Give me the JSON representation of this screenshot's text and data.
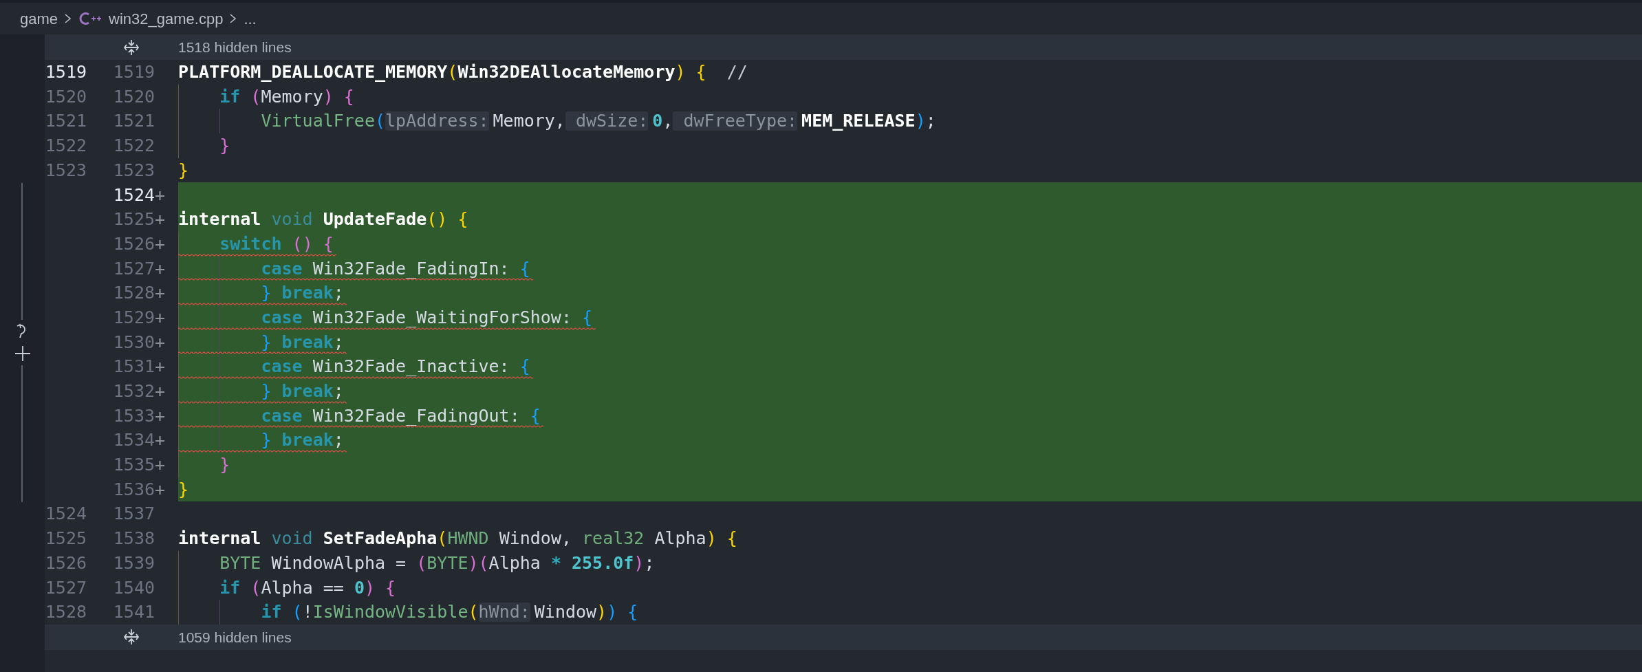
{
  "breadcrumb": [
    {
      "kind": "folder",
      "text": "game"
    },
    {
      "kind": "file",
      "text": "win32_game.cpp"
    },
    {
      "kind": "more",
      "text": "..."
    }
  ],
  "editor": {
    "hidden_top": {
      "label": "1518 hidden lines"
    },
    "lines": [
      {
        "kind": "context",
        "old": "1519",
        "new": "1519",
        "active": true,
        "error": false,
        "tokens": [
          {
            "kind": "macro",
            "text": "PLATFORM_DEALLOCATE_MEMORY"
          },
          {
            "kind": "bracket",
            "text": "(",
            "color": "#ffd700"
          },
          {
            "kind": "macro",
            "text": "Win32DEAllocateMemory"
          },
          {
            "kind": "bracket",
            "text": ")",
            "color": "#ffd700"
          },
          {
            "kind": "bracket",
            "text": "{",
            "color": "#ffd700",
            "spaced": true
          },
          {
            "kind": "comment",
            "text": "//",
            "spaced": true,
            "wide": true
          }
        ]
      },
      {
        "kind": "context",
        "old": "1520",
        "new": "1520",
        "active": false,
        "error": false,
        "guides": [
          true
        ],
        "tokens": [
          {
            "kind": "keyword",
            "text": "if"
          },
          {
            "kind": "bracket",
            "text": "(",
            "color": "#da70d6",
            "spaced": true
          },
          {
            "kind": "plain",
            "text": "Memory"
          },
          {
            "kind": "bracket",
            "text": ")",
            "color": "#da70d6"
          },
          {
            "kind": "bracket",
            "text": "{",
            "color": "#da70d6",
            "spaced": true
          }
        ]
      },
      {
        "kind": "context",
        "old": "1521",
        "new": "1521",
        "active": false,
        "error": false,
        "guides": [
          true,
          true
        ],
        "tokens": [
          {
            "kind": "call",
            "text": "VirtualFree"
          },
          {
            "kind": "bracket",
            "text": "(",
            "color": "#179fff"
          },
          {
            "kind": "hint",
            "text": "lpAddress:"
          },
          {
            "kind": "plain",
            "text": "Memory,"
          },
          {
            "kind": "hint",
            "text": "dwSize:",
            "spaced": true
          },
          {
            "kind": "number",
            "text": "0"
          },
          {
            "kind": "plain",
            "text": ","
          },
          {
            "kind": "hint",
            "text": "dwFreeType:",
            "spaced": true
          },
          {
            "kind": "constant",
            "text": "MEM_RELEASE"
          },
          {
            "kind": "bracket",
            "text": ")",
            "color": "#179fff"
          },
          {
            "kind": "plain",
            "text": ";"
          }
        ]
      },
      {
        "kind": "context",
        "old": "1522",
        "new": "1522",
        "active": false,
        "error": false,
        "guides": [
          true
        ],
        "tokens": [
          {
            "kind": "bracket",
            "text": "}",
            "color": "#da70d6"
          }
        ]
      },
      {
        "kind": "context",
        "old": "1523",
        "new": "1523",
        "active": false,
        "error": false,
        "tokens": [
          {
            "kind": "bracket",
            "text": "}",
            "color": "#ffd700"
          }
        ]
      },
      {
        "kind": "added",
        "new": "1524",
        "marker": "+",
        "active": true,
        "error": false
      },
      {
        "kind": "added",
        "new": "1525",
        "marker": "+",
        "active": false,
        "error": false,
        "tokens": [
          {
            "kind": "storage",
            "text": "internal"
          },
          {
            "kind": "type",
            "text": "void",
            "spaced": true
          },
          {
            "kind": "function",
            "text": "UpdateFade",
            "spaced": true
          },
          {
            "kind": "bracket",
            "text": "(",
            "color": "#ffd700"
          },
          {
            "kind": "bracket",
            "text": ")",
            "color": "#ffd700"
          },
          {
            "kind": "bracket",
            "text": "{",
            "color": "#ffd700",
            "spaced": true
          }
        ]
      },
      {
        "kind": "added",
        "new": "1526",
        "marker": "+",
        "active": false,
        "error": true,
        "guides": [
          true
        ],
        "tokens": [
          {
            "kind": "keyword",
            "text": "switch"
          },
          {
            "kind": "bracket",
            "text": "(",
            "color": "#da70d6",
            "spaced": true
          },
          {
            "kind": "bracket",
            "text": ")",
            "color": "#da70d6"
          },
          {
            "kind": "bracket",
            "text": "{",
            "color": "#da70d6",
            "spaced": true
          }
        ]
      },
      {
        "kind": "added",
        "new": "1527",
        "marker": "+",
        "active": false,
        "error": true,
        "guides": [
          true,
          true
        ],
        "tokens": [
          {
            "kind": "keyword",
            "text": "case"
          },
          {
            "kind": "plain",
            "text": "Win32Fade_FadingIn:",
            "spaced": true
          },
          {
            "kind": "bracket",
            "text": "{",
            "color": "#179fff",
            "spaced": true
          }
        ]
      },
      {
        "kind": "added",
        "new": "1528",
        "marker": "+",
        "active": false,
        "error": true,
        "guides": [
          true,
          true
        ],
        "tokens": [
          {
            "kind": "bracket",
            "text": "}",
            "color": "#179fff"
          },
          {
            "kind": "keyword",
            "text": "break",
            "spaced": true
          },
          {
            "kind": "plain",
            "text": ";"
          }
        ]
      },
      {
        "kind": "added",
        "new": "1529",
        "marker": "+",
        "active": false,
        "error": true,
        "guides": [
          true,
          true
        ],
        "tokens": [
          {
            "kind": "keyword",
            "text": "case"
          },
          {
            "kind": "plain",
            "text": "Win32Fade_WaitingForShow:",
            "spaced": true
          },
          {
            "kind": "bracket",
            "text": "{",
            "color": "#179fff",
            "spaced": true
          }
        ]
      },
      {
        "kind": "added",
        "new": "1530",
        "marker": "+",
        "active": false,
        "error": true,
        "guides": [
          true,
          true
        ],
        "tokens": [
          {
            "kind": "bracket",
            "text": "}",
            "color": "#179fff"
          },
          {
            "kind": "keyword",
            "text": "break",
            "spaced": true
          },
          {
            "kind": "plain",
            "text": ";"
          }
        ]
      },
      {
        "kind": "added",
        "new": "1531",
        "marker": "+",
        "active": false,
        "error": true,
        "guides": [
          true,
          true
        ],
        "tokens": [
          {
            "kind": "keyword",
            "text": "case"
          },
          {
            "kind": "plain",
            "text": "Win32Fade_Inactive:",
            "spaced": true
          },
          {
            "kind": "bracket",
            "text": "{",
            "color": "#179fff",
            "spaced": true
          }
        ]
      },
      {
        "kind": "added",
        "new": "1532",
        "marker": "+",
        "active": false,
        "error": true,
        "guides": [
          true,
          true
        ],
        "tokens": [
          {
            "kind": "bracket",
            "text": "}",
            "color": "#179fff"
          },
          {
            "kind": "keyword",
            "text": "break",
            "spaced": true
          },
          {
            "kind": "plain",
            "text": ";"
          }
        ]
      },
      {
        "kind": "added",
        "new": "1533",
        "marker": "+",
        "active": false,
        "error": true,
        "guides": [
          true,
          true
        ],
        "tokens": [
          {
            "kind": "keyword",
            "text": "case"
          },
          {
            "kind": "plain",
            "text": "Win32Fade_FadingOut:",
            "spaced": true
          },
          {
            "kind": "bracket",
            "text": "{",
            "color": "#179fff",
            "spaced": true
          }
        ]
      },
      {
        "kind": "added",
        "new": "1534",
        "marker": "+",
        "active": false,
        "error": true,
        "guides": [
          true,
          true
        ],
        "tokens": [
          {
            "kind": "bracket",
            "text": "}",
            "color": "#179fff"
          },
          {
            "kind": "keyword",
            "text": "break",
            "spaced": true
          },
          {
            "kind": "plain",
            "text": ";"
          }
        ]
      },
      {
        "kind": "added",
        "new": "1535",
        "marker": "+",
        "active": false,
        "error": false,
        "guides": [
          true
        ],
        "tokens": [
          {
            "kind": "bracket",
            "text": "}",
            "color": "#da70d6"
          }
        ]
      },
      {
        "kind": "added",
        "new": "1536",
        "marker": "+",
        "active": false,
        "error": false,
        "tokens": [
          {
            "kind": "bracket",
            "text": "}",
            "color": "#ffd700"
          }
        ]
      },
      {
        "kind": "context",
        "old": "1524",
        "new": "1537",
        "active": false,
        "error": false
      },
      {
        "kind": "context",
        "old": "1525",
        "new": "1538",
        "active": false,
        "error": false,
        "tokens": [
          {
            "kind": "storage",
            "text": "internal"
          },
          {
            "kind": "type",
            "text": "void",
            "spaced": true
          },
          {
            "kind": "function",
            "text": "SetFadeApha",
            "spaced": true
          },
          {
            "kind": "bracket",
            "text": "(",
            "color": "#ffd700"
          },
          {
            "kind": "typename",
            "text": "HWND"
          },
          {
            "kind": "plain",
            "text": "Window,",
            "spaced": true
          },
          {
            "kind": "typename",
            "text": "real32",
            "spaced": true
          },
          {
            "kind": "plain",
            "text": "Alpha",
            "spaced": true
          },
          {
            "kind": "bracket",
            "text": ")",
            "color": "#ffd700"
          },
          {
            "kind": "bracket",
            "text": "{",
            "color": "#ffd700",
            "spaced": true
          }
        ]
      },
      {
        "kind": "context",
        "old": "1526",
        "new": "1539",
        "active": false,
        "error": false,
        "guides": [
          true
        ],
        "tokens": [
          {
            "kind": "typename",
            "text": "BYTE"
          },
          {
            "kind": "plain",
            "text": "WindowAlpha =",
            "spaced": true
          },
          {
            "kind": "bracket",
            "text": "(",
            "color": "#da70d6",
            "spaced": true
          },
          {
            "kind": "typename",
            "text": "BYTE"
          },
          {
            "kind": "bracket",
            "text": ")",
            "color": "#da70d6"
          },
          {
            "kind": "bracket",
            "text": "(",
            "color": "#da70d6"
          },
          {
            "kind": "plain",
            "text": "Alpha"
          },
          {
            "kind": "operator",
            "text": "*",
            "spaced": true
          },
          {
            "kind": "number",
            "text": "255.0f",
            "spaced": true
          },
          {
            "kind": "bracket",
            "text": ")",
            "color": "#da70d6"
          },
          {
            "kind": "plain",
            "text": ";"
          }
        ]
      },
      {
        "kind": "context",
        "old": "1527",
        "new": "1540",
        "active": false,
        "error": false,
        "guides": [
          true
        ],
        "tokens": [
          {
            "kind": "keyword",
            "text": "if"
          },
          {
            "kind": "bracket",
            "text": "(",
            "color": "#da70d6",
            "spaced": true
          },
          {
            "kind": "plain",
            "text": "Alpha =="
          },
          {
            "kind": "number",
            "text": "0",
            "spaced": true
          },
          {
            "kind": "bracket",
            "text": ")",
            "color": "#da70d6"
          },
          {
            "kind": "bracket",
            "text": "{",
            "color": "#da70d6",
            "spaced": true
          }
        ]
      },
      {
        "kind": "context",
        "old": "1528",
        "new": "1541",
        "active": false,
        "error": false,
        "guides": [
          true,
          true
        ],
        "tokens": [
          {
            "kind": "keyword",
            "text": "if"
          },
          {
            "kind": "bracket",
            "text": "(",
            "color": "#179fff",
            "spaced": true
          },
          {
            "kind": "plain",
            "text": "!"
          },
          {
            "kind": "call",
            "text": "IsWindowVisible"
          },
          {
            "kind": "bracket",
            "text": "(",
            "color": "#ffd700"
          },
          {
            "kind": "hint",
            "text": "hWnd:"
          },
          {
            "kind": "plain",
            "text": "Window"
          },
          {
            "kind": "bracket",
            "text": ")",
            "color": "#ffd700"
          },
          {
            "kind": "bracket",
            "text": ")",
            "color": "#179fff"
          },
          {
            "kind": "bracket",
            "text": "{",
            "color": "#179fff",
            "spaced": true
          }
        ]
      }
    ],
    "hidden_bottom": {
      "label": "1059 hidden lines"
    }
  }
}
